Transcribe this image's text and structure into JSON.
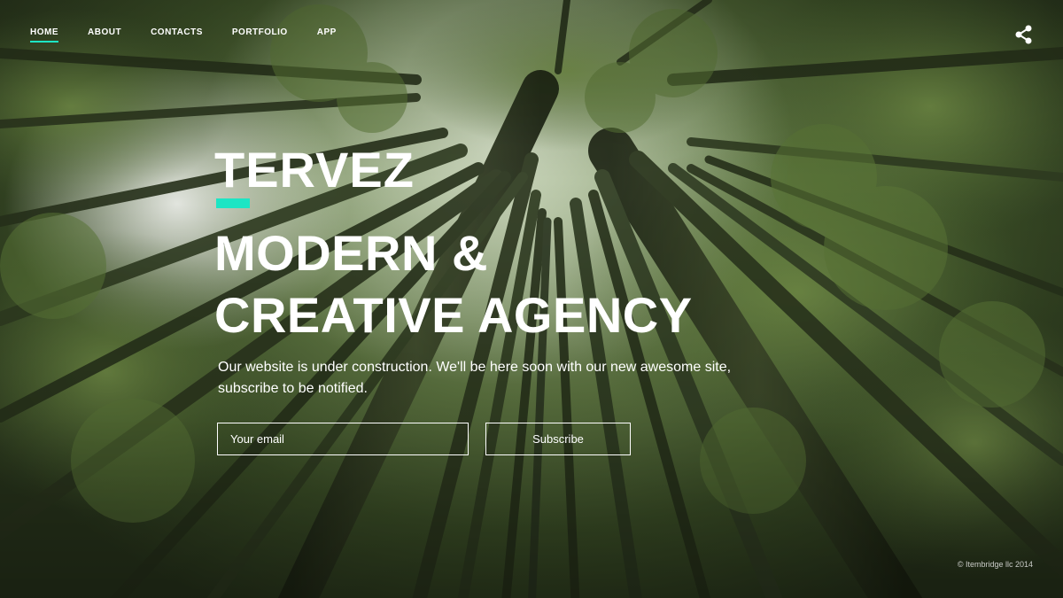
{
  "nav": {
    "items": [
      {
        "label": "HOME",
        "active": true
      },
      {
        "label": "ABOUT",
        "active": false
      },
      {
        "label": "CONTACTS",
        "active": false
      },
      {
        "label": "PORTFOLIO",
        "active": false
      },
      {
        "label": "APP",
        "active": false
      }
    ],
    "share_icon": "share-icon"
  },
  "hero": {
    "brand": "TERVEZ",
    "headline_line1": "MODERN &",
    "headline_line2": "CREATIVE AGENCY",
    "subtitle": "Our website is under construction. We'll be here soon with our new awesome site, subscribe to be notified.",
    "email_placeholder": "Your email",
    "subscribe_label": "Subscribe"
  },
  "footer": {
    "copyright": "© Itembridge llc 2014"
  },
  "colors": {
    "accent": "#1de5c4",
    "text": "#ffffff"
  }
}
